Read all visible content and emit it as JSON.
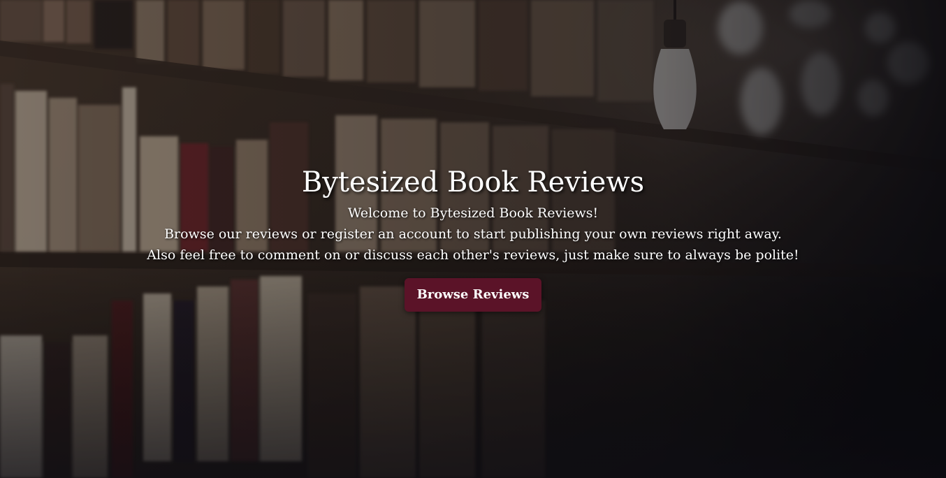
{
  "hero": {
    "title": "Bytesized Book Reviews",
    "lines": [
      "Welcome to Bytesized Book Reviews!",
      "Browse our reviews or register an account to start publishing your own reviews right away.",
      "Also feel free to comment on or discuss each other's reviews, just make sure to always be polite!"
    ],
    "cta_label": "Browse Reviews"
  },
  "colors": {
    "button_bg": "#5b1328",
    "text": "#ffffff",
    "overlay": "#1b1a1e"
  }
}
